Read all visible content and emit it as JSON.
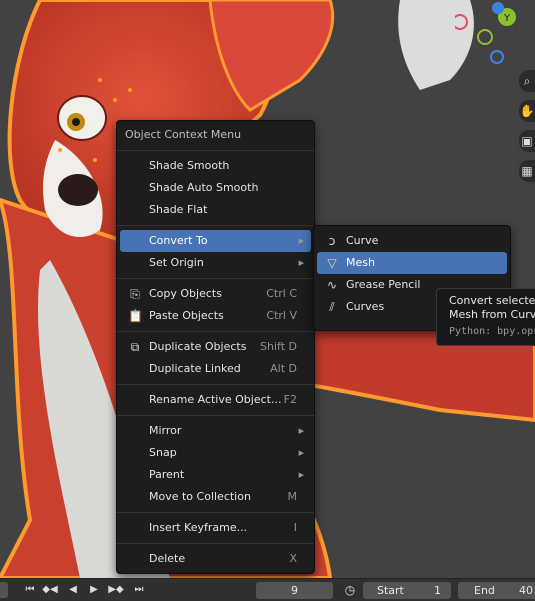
{
  "context_menu": {
    "title": "Object Context Menu",
    "items": {
      "shade_smooth": "Shade Smooth",
      "shade_auto_smooth": "Shade Auto Smooth",
      "shade_flat": "Shade Flat",
      "convert_to": "Convert To",
      "set_origin": "Set Origin",
      "copy_objects": "Copy Objects",
      "copy_shortcut": "Ctrl C",
      "paste_objects": "Paste Objects",
      "paste_shortcut": "Ctrl V",
      "duplicate_objects": "Duplicate Objects",
      "duplicate_shortcut": "Shift D",
      "duplicate_linked": "Duplicate Linked",
      "duplicate_linked_shortcut": "Alt D",
      "rename": "Rename Active Object...",
      "rename_shortcut": "F2",
      "mirror": "Mirror",
      "snap": "Snap",
      "parent": "Parent",
      "move_to_collection": "Move to Collection",
      "move_shortcut": "M",
      "insert_keyframe": "Insert Keyframe...",
      "insert_shortcut": "I",
      "delete": "Delete",
      "delete_shortcut": "X"
    }
  },
  "submenu": {
    "items": [
      "Curve",
      "Mesh",
      "Grease Pencil",
      "Curves"
    ],
    "active": "Mesh"
  },
  "tooltip": {
    "line1": "Convert selected",
    "line2": "Mesh from Curve,",
    "python": "Python: bpy.ops"
  },
  "timeline": {
    "current_frame": "9",
    "start_label": "Start",
    "start_value": "1",
    "end_label": "End",
    "end_value": "40"
  },
  "gizmo": {
    "y_label": "Y",
    "colors": {
      "x": "#e04d5c",
      "y": "#8ac22e",
      "z": "#3b82e6"
    }
  },
  "colors": {
    "accent": "#4772b3",
    "menu_bg": "#1d1d1d"
  }
}
